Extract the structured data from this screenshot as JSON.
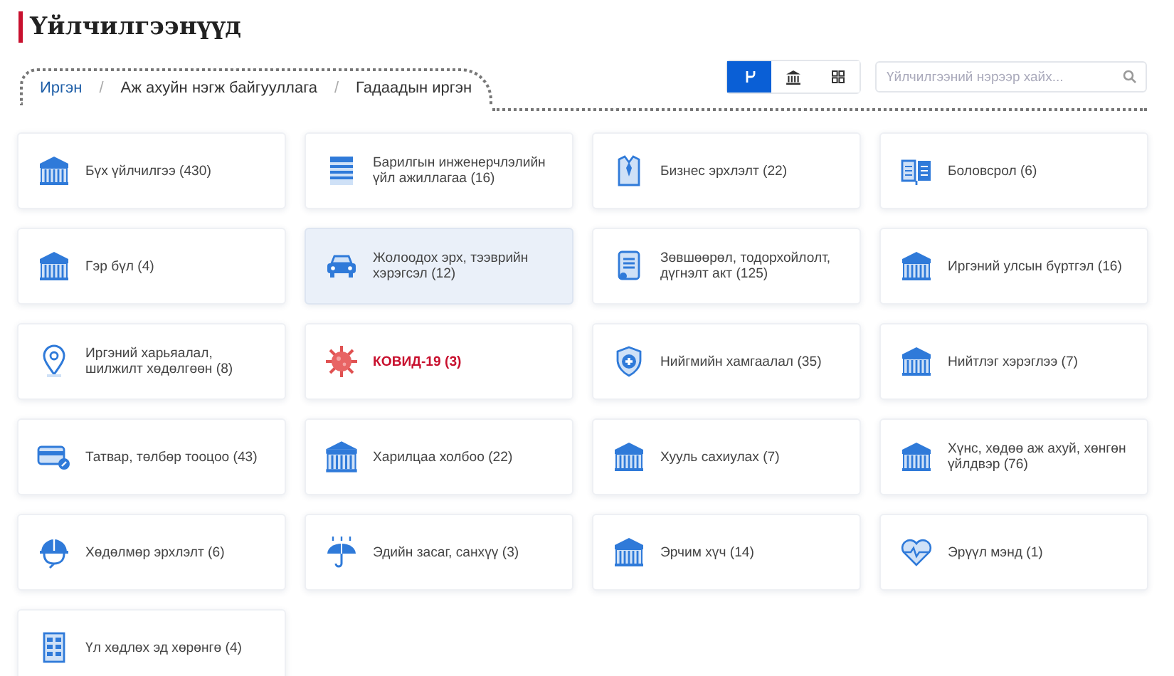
{
  "page": {
    "title": "Үйлчилгээнүүд"
  },
  "breadcrumb": [
    {
      "kind": "link",
      "label": "Иргэн",
      "selected": true
    },
    {
      "kind": "separator",
      "label": "/"
    },
    {
      "kind": "link",
      "label": "Аж ахуйн нэгж байгууллага",
      "selected": false
    },
    {
      "kind": "separator",
      "label": "/"
    },
    {
      "kind": "link",
      "label": "Гадаадын иргэн",
      "selected": false
    }
  ],
  "view_buttons": [
    {
      "kind": "flow",
      "selected": true
    },
    {
      "kind": "bank",
      "selected": false
    },
    {
      "kind": "grid",
      "selected": false
    }
  ],
  "search": {
    "placeholder": "Үйлчилгээний нэрээр хайх..."
  },
  "services": [
    {
      "kind": "building",
      "label": "Бүх үйлчилгээ (430)",
      "highlighted": false,
      "alert": false
    },
    {
      "kind": "tower",
      "label": "Барилгын инженерчлэлийн үйл ажиллагаа (16)",
      "highlighted": false,
      "alert": false
    },
    {
      "kind": "suit",
      "label": "Бизнес эрхлэлт (22)",
      "highlighted": false,
      "alert": false
    },
    {
      "kind": "book",
      "label": "Боловсрол (6)",
      "highlighted": false,
      "alert": false
    },
    {
      "kind": "building",
      "label": "Гэр бүл (4)",
      "highlighted": false,
      "alert": false
    },
    {
      "kind": "car",
      "label": "Жолоодох эрх, тээврийн хэрэгсэл (12)",
      "highlighted": true,
      "alert": false
    },
    {
      "kind": "document",
      "label": "Зөвшөөрөл, тодорхойлолт, дүгнэлт акт (125)",
      "highlighted": false,
      "alert": false
    },
    {
      "kind": "building",
      "label": "Иргэний улсын бүртгэл (16)",
      "highlighted": false,
      "alert": false
    },
    {
      "kind": "pin",
      "label": "Иргэний харьяалал, шилжилт хөдөлгөөн (8)",
      "highlighted": false,
      "alert": false
    },
    {
      "kind": "virus",
      "label": "КОВИД-19 (3)",
      "highlighted": false,
      "alert": true
    },
    {
      "kind": "shield",
      "label": "Нийгмийн хамгаалал (35)",
      "highlighted": false,
      "alert": false
    },
    {
      "kind": "building",
      "label": "Нийтлэг хэрэглээ (7)",
      "highlighted": false,
      "alert": false
    },
    {
      "kind": "card",
      "label": "Татвар, төлбөр тооцоо (43)",
      "highlighted": false,
      "alert": false
    },
    {
      "kind": "building-large",
      "label": "Харилцаа холбоо (22)",
      "highlighted": false,
      "alert": false
    },
    {
      "kind": "building",
      "label": "Хууль сахиулах (7)",
      "highlighted": false,
      "alert": false
    },
    {
      "kind": "building",
      "label": "Хүнс, хөдөө аж ахуй, хөнгөн үйлдвэр (76)",
      "highlighted": false,
      "alert": false
    },
    {
      "kind": "helmet",
      "label": "Хөдөлмөр эрхлэлт (6)",
      "highlighted": false,
      "alert": false
    },
    {
      "kind": "umbrella",
      "label": "Эдийн засаг, санхүү (3)",
      "highlighted": false,
      "alert": false
    },
    {
      "kind": "building",
      "label": "Эрчим хүч (14)",
      "highlighted": false,
      "alert": false
    },
    {
      "kind": "heart",
      "label": "Эрүүл мэнд (1)",
      "highlighted": false,
      "alert": false
    },
    {
      "kind": "estate",
      "label": "Үл хөдлөх эд хөрөнгө (4)",
      "highlighted": false,
      "alert": false
    }
  ]
}
